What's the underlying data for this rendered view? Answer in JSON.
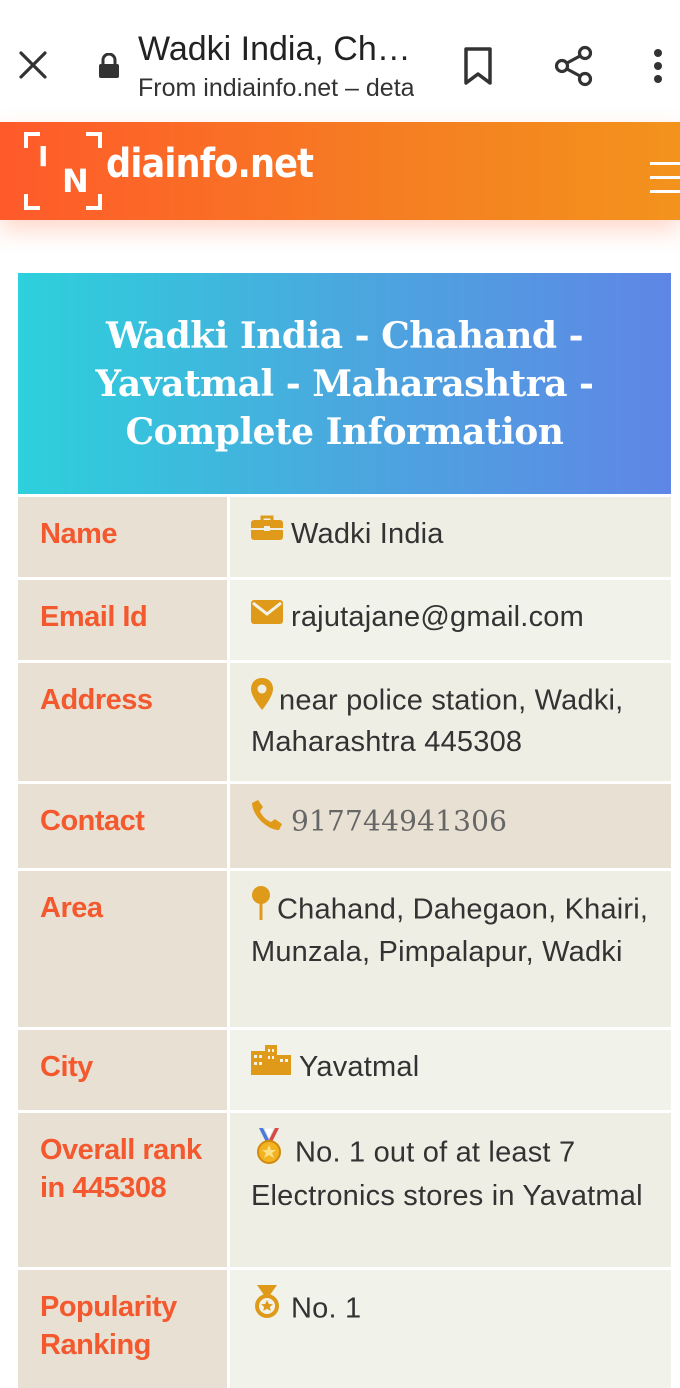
{
  "browser": {
    "title": "Wadki India, Chahand - Yavatmal",
    "url": "From indiainfo.net – details",
    "close_icon": "close-icon",
    "lock_icon": "lock-icon",
    "bookmark_icon": "bookmark-icon",
    "share_icon": "share-icon",
    "more_icon": "more-vert-icon"
  },
  "site": {
    "logo_i": "I",
    "logo_n": "N",
    "logo_text": "diainfo.net",
    "menu_icon": "hamburger-menu-icon",
    "header_gradient": [
      "#ff5a2a",
      "#f3931c"
    ]
  },
  "card": {
    "title": "Wadki India - Chahand - Yavatmal - Maharashtra - Complete Information",
    "rows": [
      {
        "label": "Name",
        "icon": "briefcase-icon",
        "value": "Wadki India"
      },
      {
        "label": "Email Id",
        "icon": "envelope-icon",
        "value": "rajutajane@gmail.com"
      },
      {
        "label": "Address",
        "icon": "map-marker-icon",
        "value": "near police station, Wadki, Maharashtra 445308"
      },
      {
        "label": "Contact",
        "icon": "phone-icon",
        "value": "917744941306"
      },
      {
        "label": "Area",
        "icon": "pin-icon",
        "value": "Chahand, Dahegaon, Khairi, Munzala, Pimpalapur, Wadki"
      },
      {
        "label": "City",
        "icon": "city-icon",
        "value": "Yavatmal"
      },
      {
        "label": "Overall rank in 445308",
        "icon": "medal-icon",
        "value": "No. 1 out of at least 7 Electronics stores in Yavatmal"
      },
      {
        "label": "Popularity Ranking",
        "icon": "award-icon",
        "value": "No. 1"
      }
    ],
    "colors": {
      "label_text": "#f4582e",
      "icon": "#e09a1a",
      "label_bg": "#e8e1d3",
      "value_bg": "#eeeee4"
    }
  }
}
